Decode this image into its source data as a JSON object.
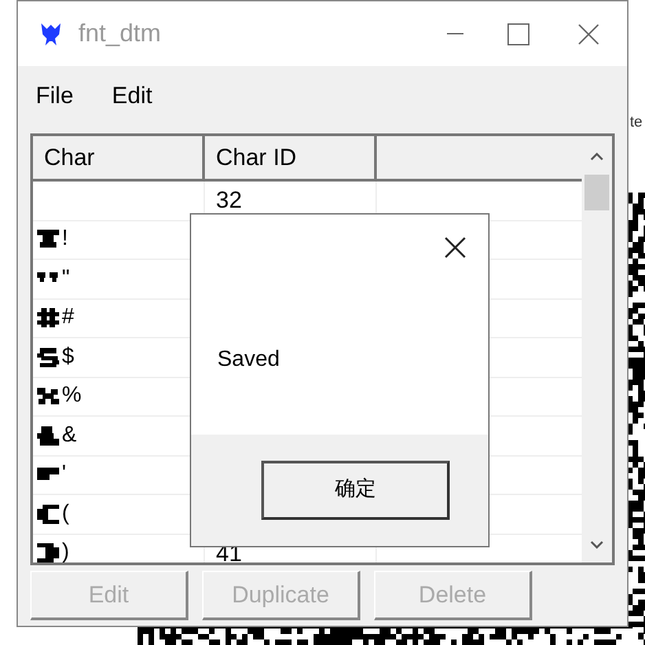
{
  "window": {
    "title": "fnt_dtm"
  },
  "menu": [
    "File",
    "Edit"
  ],
  "table": {
    "columns": [
      "Char",
      "Char ID"
    ],
    "rows": [
      {
        "char_id": "32"
      },
      {
        "char": "!"
      },
      {
        "char": "\""
      },
      {
        "char": "#"
      },
      {
        "char": "$"
      },
      {
        "char": "%"
      },
      {
        "char": "&"
      },
      {
        "char": "'"
      },
      {
        "char": "("
      },
      {
        "char": ")",
        "char_id": "41"
      }
    ]
  },
  "buttons": [
    {
      "label": "Edit",
      "disabled": true
    },
    {
      "label": "Duplicate",
      "disabled": true
    },
    {
      "label": "Delete",
      "disabled": true
    }
  ],
  "dialog": {
    "message": "Saved",
    "button": "确定"
  },
  "background_window": {
    "text": "te"
  }
}
